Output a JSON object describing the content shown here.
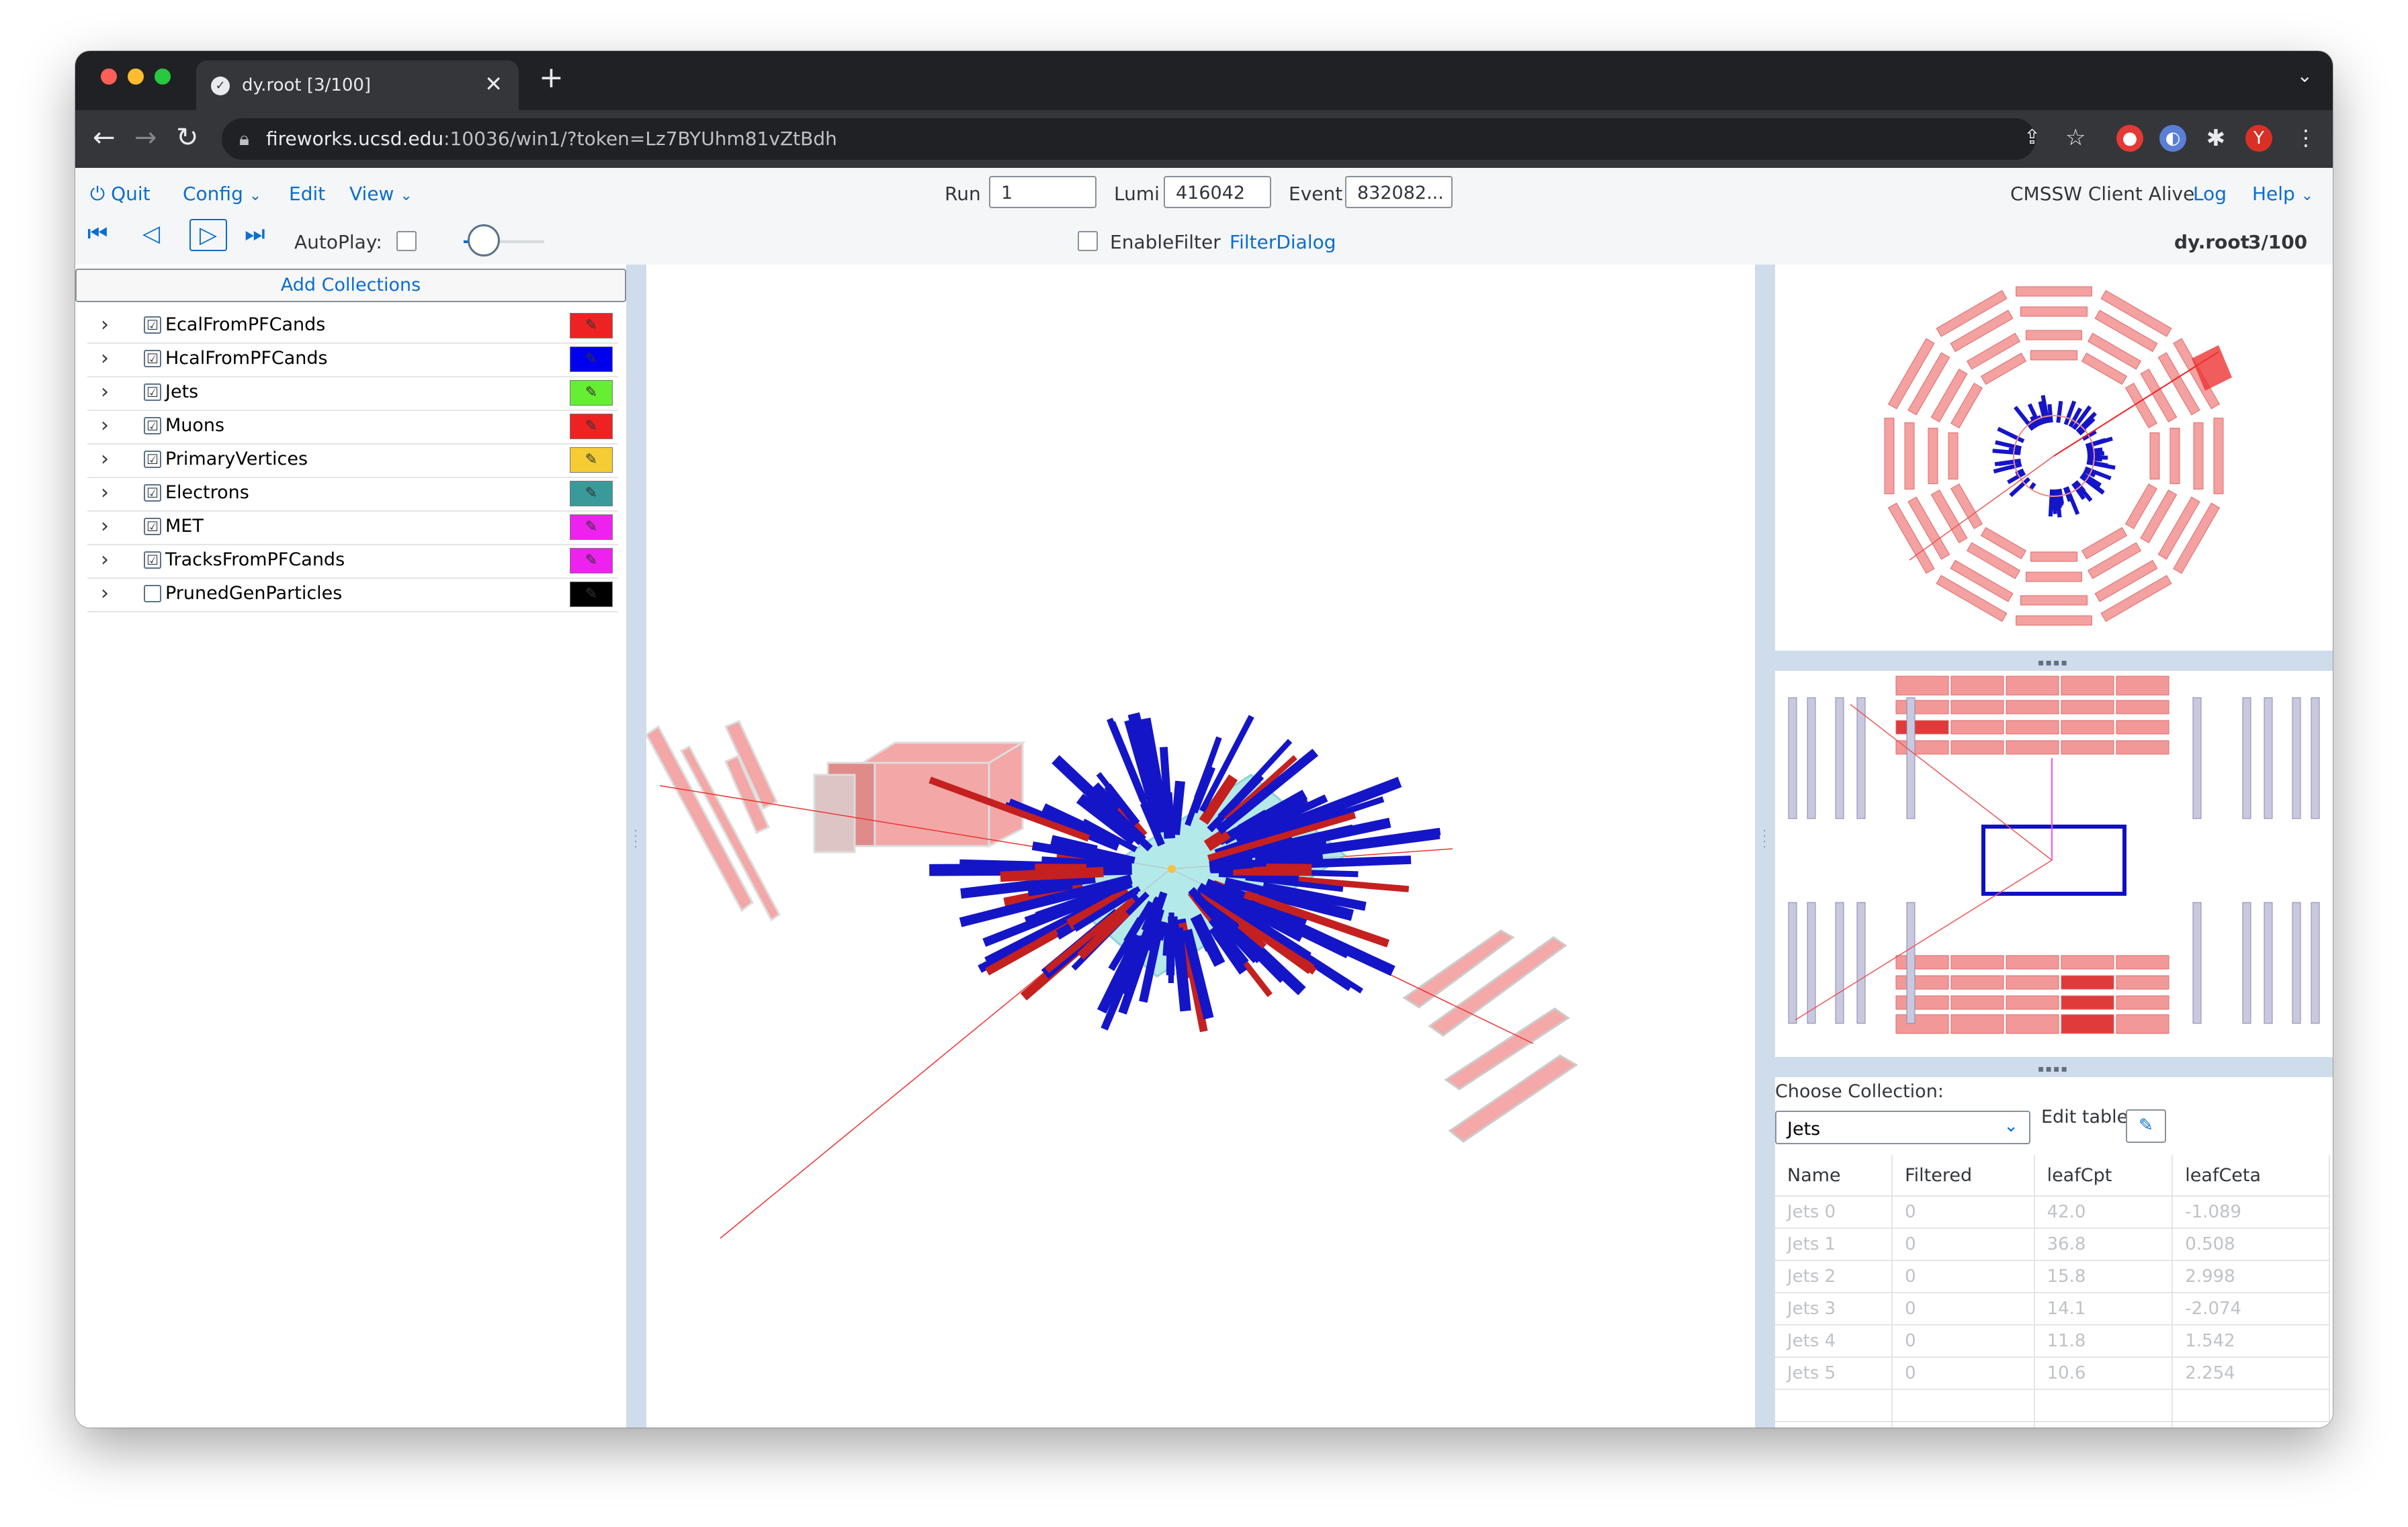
{
  "browser": {
    "tab_title": "dy.root [3/100]",
    "tab_close": "✕",
    "new_tab": "+",
    "tab_menu": "⌄",
    "url_host": "fireworks.ucsd.edu",
    "url_rest": ":10036/win1/?token=Lz7BYUhm81vZtBdh",
    "nav_back": "←",
    "nav_forward": "→",
    "nav_reload": "↻"
  },
  "menu": {
    "quit": "Quit",
    "config": "Config",
    "edit": "Edit",
    "view": "View",
    "status": "CMSSW Client Alive",
    "log": "Log",
    "help": "Help"
  },
  "event": {
    "run_label": "Run",
    "run_value": "1",
    "lumi_label": "Lumi",
    "lumi_value": "416042",
    "event_label": "Event",
    "event_value": "832082..."
  },
  "player": {
    "autoplay_label": "AutoPlay:",
    "enable_filter_label": "EnableFilter",
    "filter_dialog_label": "FilterDialog",
    "file_name": "dy.root",
    "file_position": "3/100"
  },
  "collections": {
    "add_button": "Add Collections",
    "items": [
      {
        "label": "EcalFromPFCands",
        "checked": "☑",
        "color": "#ee2222"
      },
      {
        "label": "HcalFromPFCands",
        "checked": "☑",
        "color": "#0000ee"
      },
      {
        "label": "Jets",
        "checked": "☑",
        "color": "#66ee33"
      },
      {
        "label": "Muons",
        "checked": "☑",
        "color": "#ee2222"
      },
      {
        "label": "PrimaryVertices",
        "checked": "☑",
        "color": "#f5cc33"
      },
      {
        "label": "Electrons",
        "checked": "☑",
        "color": "#3a9a9a"
      },
      {
        "label": "MET",
        "checked": "☑",
        "color": "#ee22ee"
      },
      {
        "label": "TracksFromPFCands",
        "checked": "☑",
        "color": "#ee22ee"
      },
      {
        "label": "PrunedGenParticles",
        "checked": "",
        "color": "#000000"
      }
    ]
  },
  "table": {
    "choose_label": "Choose Collection:",
    "selected": "Jets",
    "edit_label": "Edit table:",
    "columns": [
      "Name",
      "Filtered",
      "leafCpt",
      "leafCeta"
    ],
    "rows": [
      [
        "Jets 0",
        "0",
        "42.0",
        "-1.089"
      ],
      [
        "Jets 1",
        "0",
        "36.8",
        "0.508"
      ],
      [
        "Jets 2",
        "0",
        "15.8",
        "2.998"
      ],
      [
        "Jets 3",
        "0",
        "14.1",
        "-2.074"
      ],
      [
        "Jets 4",
        "0",
        "11.8",
        "1.542"
      ],
      [
        "Jets 5",
        "0",
        "10.6",
        "2.254"
      ]
    ]
  },
  "colors": {
    "accent": "#0a6ed1",
    "calo_red": "#ee4444",
    "hcal_blue": "#1010c0",
    "muon_chamber": "#f08a8a",
    "beam_cyan": "#a8e6e6"
  }
}
